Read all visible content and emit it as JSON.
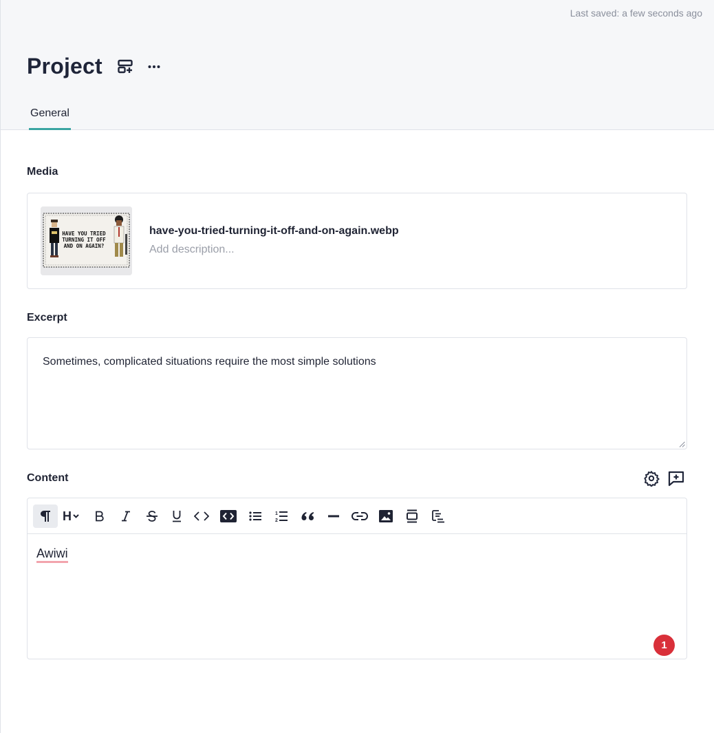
{
  "header": {
    "last_saved": "Last saved: a few seconds ago",
    "title": "Project",
    "icons": [
      "layout-add-icon",
      "more-icon"
    ]
  },
  "tabs": [
    {
      "label": "General",
      "active": true
    }
  ],
  "media": {
    "label": "Media",
    "filename": "have-you-tried-turning-it-off-and-on-again.webp",
    "description_placeholder": "Add description...",
    "thumbnail_text": "HAVE YOU TRIED TURNING IT OFF AND ON AGAIN?"
  },
  "excerpt": {
    "label": "Excerpt",
    "value": "Sometimes, complicated situations require the most simple solutions"
  },
  "content": {
    "label": "Content",
    "header_icons": [
      "settings-icon",
      "comment-add-icon"
    ],
    "toolbar": [
      "paragraph-icon",
      "heading-dropdown-icon",
      "bold-icon",
      "italic-icon",
      "strikethrough-icon",
      "underline-icon",
      "code-icon",
      "code-block-icon",
      "bullet-list-icon",
      "numbered-list-icon",
      "blockquote-icon",
      "horizontal-rule-icon",
      "link-icon",
      "image-icon",
      "embed-icon",
      "block-settings-icon"
    ],
    "text": "Awiwi",
    "issue_count": "1"
  },
  "colors": {
    "accent": "#3aa5a2",
    "badge": "#d9303a",
    "spellcheck": "#f2a4ad",
    "header_bg": "#f6f7f9"
  }
}
